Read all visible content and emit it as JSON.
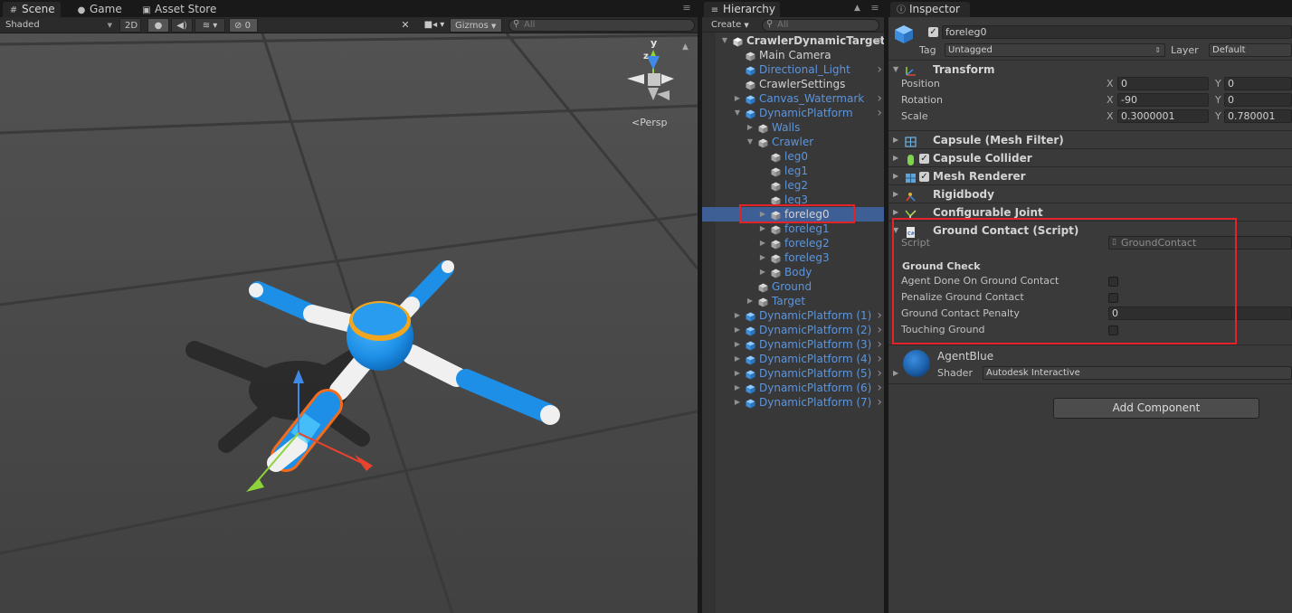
{
  "scene_panel": {
    "tabs": [
      {
        "label": "Scene",
        "icon": "grid-icon"
      },
      {
        "label": "Game",
        "icon": "pacman-icon"
      },
      {
        "label": "Asset Store",
        "icon": "lock-icon"
      }
    ],
    "toolbar": {
      "shading_mode": "Shaded",
      "mode_2d": "2D",
      "hidden_count": "0",
      "gizmos_label": "Gizmos",
      "search_placeholder": "All"
    },
    "view": {
      "projection_label": "Persp",
      "axis_labels": {
        "y": "y",
        "z": "z"
      }
    }
  },
  "hierarchy": {
    "tab_label": "Hierarchy",
    "create_label": "Create",
    "search_placeholder": "All",
    "items": [
      {
        "label": "CrawlerDynamicTarget",
        "depth": 0,
        "expand": "down",
        "color": "white",
        "bold": true,
        "icon": "unity-scene-icon",
        "more": true
      },
      {
        "label": "Main Camera",
        "depth": 1,
        "expand": "none",
        "color": "white",
        "icon": "gameobject-icon"
      },
      {
        "label": "Directional_Light",
        "depth": 1,
        "expand": "none",
        "color": "blue",
        "icon": "prefab-icon",
        "more": true
      },
      {
        "label": "CrawlerSettings",
        "depth": 1,
        "expand": "none",
        "color": "white",
        "icon": "gameobject-icon"
      },
      {
        "label": "Canvas_Watermark",
        "depth": 1,
        "expand": "right",
        "color": "blue",
        "icon": "prefab-icon",
        "more": true
      },
      {
        "label": "DynamicPlatform",
        "depth": 1,
        "expand": "down",
        "color": "blue",
        "icon": "prefab-icon",
        "more": true
      },
      {
        "label": "Walls",
        "depth": 2,
        "expand": "right",
        "color": "blue",
        "icon": "gameobject-icon"
      },
      {
        "label": "Crawler",
        "depth": 2,
        "expand": "down",
        "color": "blue",
        "icon": "gameobject-icon"
      },
      {
        "label": "leg0",
        "depth": 3,
        "expand": "none",
        "color": "blue",
        "icon": "gameobject-icon"
      },
      {
        "label": "leg1",
        "depth": 3,
        "expand": "none",
        "color": "blue",
        "icon": "gameobject-icon"
      },
      {
        "label": "leg2",
        "depth": 3,
        "expand": "none",
        "color": "blue",
        "icon": "gameobject-icon"
      },
      {
        "label": "leg3",
        "depth": 3,
        "expand": "none",
        "color": "blue",
        "icon": "gameobject-icon"
      },
      {
        "label": "foreleg0",
        "depth": 3,
        "expand": "right",
        "color": "white",
        "icon": "gameobject-icon",
        "selected": true
      },
      {
        "label": "foreleg1",
        "depth": 3,
        "expand": "right",
        "color": "blue",
        "icon": "gameobject-icon"
      },
      {
        "label": "foreleg2",
        "depth": 3,
        "expand": "right",
        "color": "blue",
        "icon": "gameobject-icon"
      },
      {
        "label": "foreleg3",
        "depth": 3,
        "expand": "right",
        "color": "blue",
        "icon": "gameobject-icon"
      },
      {
        "label": "Body",
        "depth": 3,
        "expand": "right",
        "color": "blue",
        "icon": "gameobject-icon"
      },
      {
        "label": "Ground",
        "depth": 2,
        "expand": "none",
        "color": "blue",
        "icon": "gameobject-icon"
      },
      {
        "label": "Target",
        "depth": 2,
        "expand": "right",
        "color": "blue",
        "icon": "gameobject-icon"
      },
      {
        "label": "DynamicPlatform (1)",
        "depth": 1,
        "expand": "right",
        "color": "blue",
        "icon": "prefab-icon",
        "more": true
      },
      {
        "label": "DynamicPlatform (2)",
        "depth": 1,
        "expand": "right",
        "color": "blue",
        "icon": "prefab-icon",
        "more": true
      },
      {
        "label": "DynamicPlatform (3)",
        "depth": 1,
        "expand": "right",
        "color": "blue",
        "icon": "prefab-icon",
        "more": true
      },
      {
        "label": "DynamicPlatform (4)",
        "depth": 1,
        "expand": "right",
        "color": "blue",
        "icon": "prefab-icon",
        "more": true
      },
      {
        "label": "DynamicPlatform (5)",
        "depth": 1,
        "expand": "right",
        "color": "blue",
        "icon": "prefab-icon",
        "more": true
      },
      {
        "label": "DynamicPlatform (6)",
        "depth": 1,
        "expand": "right",
        "color": "blue",
        "icon": "prefab-icon",
        "more": true
      },
      {
        "label": "DynamicPlatform (7)",
        "depth": 1,
        "expand": "right",
        "color": "blue",
        "icon": "prefab-icon",
        "more": true
      }
    ]
  },
  "inspector": {
    "tab_label": "Inspector",
    "object_name": "foreleg0",
    "active": true,
    "tag_label": "Tag",
    "tag_value": "Untagged",
    "layer_label": "Layer",
    "layer_value": "Default",
    "transform": {
      "title": "Transform",
      "position_label": "Position",
      "rotation_label": "Rotation",
      "scale_label": "Scale",
      "position": {
        "x": "0",
        "y": "0"
      },
      "rotation": {
        "x": "-90",
        "y": "0"
      },
      "scale": {
        "x": "0.3000001",
        "y": "0.780001"
      }
    },
    "components": [
      {
        "title": "Capsule (Mesh Filter)",
        "icon": "mesh-filter-icon",
        "checkbox": false
      },
      {
        "title": "Capsule Collider",
        "icon": "capsule-collider-icon",
        "checkbox": true
      },
      {
        "title": "Mesh Renderer",
        "icon": "mesh-renderer-icon",
        "checkbox": true
      },
      {
        "title": "Rigidbody",
        "icon": "rigidbody-icon",
        "checkbox": false
      },
      {
        "title": "Configurable Joint",
        "icon": "joint-icon",
        "checkbox": false
      }
    ],
    "ground_contact": {
      "title": "Ground Contact (Script)",
      "script_label": "Script",
      "script_value": "GroundContact",
      "section_header": "Ground Check",
      "agent_done_label": "Agent Done On Ground Contact",
      "agent_done": false,
      "penalize_label": "Penalize Ground Contact",
      "penalize": false,
      "penalty_label": "Ground Contact Penalty",
      "penalty_value": "0",
      "touching_label": "Touching Ground",
      "touching": false
    },
    "material": {
      "name": "AgentBlue",
      "shader_label": "Shader",
      "shader_value": "Autodesk Interactive"
    },
    "add_component_label": "Add Component"
  },
  "colors": {
    "highlight_box": "#e3222a",
    "selection": "#3e5f96",
    "agent_blue": "#1d8fe6",
    "link_blue": "#5b95df"
  }
}
